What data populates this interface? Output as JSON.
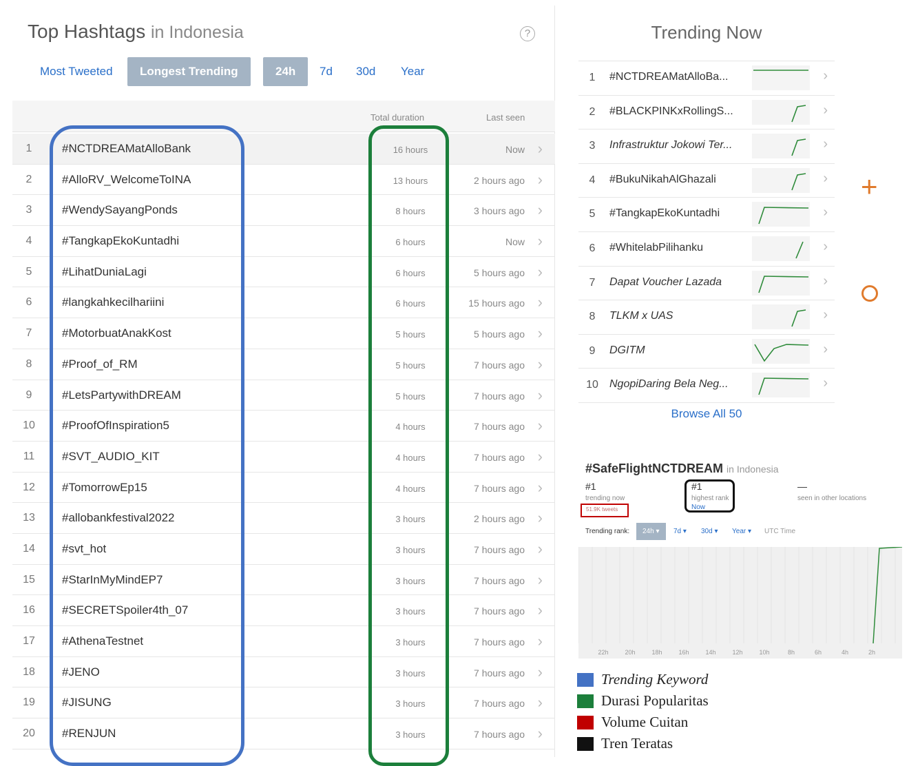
{
  "left": {
    "title": "Top Hashtags",
    "location": "in Indonesia",
    "help_icon": "?",
    "tabs": {
      "most_tweeted": "Most Tweeted",
      "longest_trending": "Longest Trending"
    },
    "periods": {
      "p24h": "24h",
      "p7d": "7d",
      "p30d": "30d",
      "year": "Year"
    },
    "columns": {
      "total_duration": "Total duration",
      "last_seen": "Last seen"
    },
    "rows": [
      {
        "rank": "1",
        "name": "#NCTDREAMatAlloBank",
        "duration": "16 hours",
        "last_seen": "Now"
      },
      {
        "rank": "2",
        "name": "#AlloRV_WelcomeToINA",
        "duration": "13 hours",
        "last_seen": "2 hours ago"
      },
      {
        "rank": "3",
        "name": "#WendySayangPonds",
        "duration": "8 hours",
        "last_seen": "3 hours ago"
      },
      {
        "rank": "4",
        "name": "#TangkapEkoKuntadhi",
        "duration": "6 hours",
        "last_seen": "Now"
      },
      {
        "rank": "5",
        "name": "#LihatDuniaLagi",
        "duration": "6 hours",
        "last_seen": "5 hours ago"
      },
      {
        "rank": "6",
        "name": "#langkahkecilhariini",
        "duration": "6 hours",
        "last_seen": "15 hours ago"
      },
      {
        "rank": "7",
        "name": "#MotorbuatAnakKost",
        "duration": "5 hours",
        "last_seen": "5 hours ago"
      },
      {
        "rank": "8",
        "name": "#Proof_of_RM",
        "duration": "5 hours",
        "last_seen": "7 hours ago"
      },
      {
        "rank": "9",
        "name": "#LetsPartywithDREAM",
        "duration": "5 hours",
        "last_seen": "7 hours ago"
      },
      {
        "rank": "10",
        "name": "#ProofOfInspiration5",
        "duration": "4 hours",
        "last_seen": "7 hours ago"
      },
      {
        "rank": "11",
        "name": "#SVT_AUDIO_KIT",
        "duration": "4 hours",
        "last_seen": "7 hours ago"
      },
      {
        "rank": "12",
        "name": "#TomorrowEp15",
        "duration": "4 hours",
        "last_seen": "7 hours ago"
      },
      {
        "rank": "13",
        "name": "#allobankfestival2022",
        "duration": "3 hours",
        "last_seen": "2 hours ago"
      },
      {
        "rank": "14",
        "name": "#svt_hot",
        "duration": "3 hours",
        "last_seen": "7 hours ago"
      },
      {
        "rank": "15",
        "name": "#StarInMyMindEP7",
        "duration": "3 hours",
        "last_seen": "7 hours ago"
      },
      {
        "rank": "16",
        "name": "#SECRETSpoiler4th_07",
        "duration": "3 hours",
        "last_seen": "7 hours ago"
      },
      {
        "rank": "17",
        "name": "#AthenaTestnet",
        "duration": "3 hours",
        "last_seen": "7 hours ago"
      },
      {
        "rank": "18",
        "name": "#JENO",
        "duration": "3 hours",
        "last_seen": "7 hours ago"
      },
      {
        "rank": "19",
        "name": "#JISUNG",
        "duration": "3 hours",
        "last_seen": "7 hours ago"
      },
      {
        "rank": "20",
        "name": "#RENJUN",
        "duration": "3 hours",
        "last_seen": "7 hours ago"
      }
    ]
  },
  "trending": {
    "title": "Trending Now",
    "browse": "Browse All 50",
    "items": [
      {
        "rank": "1",
        "name": "#NCTDREAMatAlloBa...",
        "italic": false,
        "spark": "flat"
      },
      {
        "rank": "2",
        "name": "#BLACKPINKxRollingS...",
        "italic": false,
        "spark": "rise"
      },
      {
        "rank": "3",
        "name": "Infrastruktur Jokowi Ter...",
        "italic": true,
        "spark": "rise"
      },
      {
        "rank": "4",
        "name": "#BukuNikahAlGhazali",
        "italic": false,
        "spark": "rise"
      },
      {
        "rank": "5",
        "name": "#TangkapEkoKuntadhi",
        "italic": false,
        "spark": "risehold"
      },
      {
        "rank": "6",
        "name": "#WhitelabPilihanku",
        "italic": false,
        "spark": "riselate"
      },
      {
        "rank": "7",
        "name": "Dapat Voucher Lazada",
        "italic": true,
        "spark": "risehold"
      },
      {
        "rank": "8",
        "name": "TLKM x UAS",
        "italic": true,
        "spark": "rise"
      },
      {
        "rank": "9",
        "name": "DGITM",
        "italic": true,
        "spark": "dip"
      },
      {
        "rank": "10",
        "name": "NgopiDaring Bela Neg...",
        "italic": true,
        "spark": "risehold"
      }
    ]
  },
  "detail": {
    "hashtag": "#SafeFlightNCTDREAM",
    "location": "in Indonesia",
    "trending_now_value": "#1",
    "trending_now_label": "trending now",
    "tweet_count": "51.9K tweets",
    "highest_rank_value": "#1",
    "highest_rank_label": "highest rank",
    "highest_rank_when": "Now",
    "other_locations_value": "—",
    "other_locations_label": "seen in other locations",
    "rank_label": "Trending rank:",
    "rank_24h": "24h",
    "rank_7d": "7d",
    "rank_30d": "30d",
    "rank_year": "Year",
    "rank_utc": "UTC Time",
    "x_ticks": [
      "22h",
      "20h",
      "18h",
      "16h",
      "14h",
      "12h",
      "10h",
      "8h",
      "6h",
      "4h",
      "2h"
    ]
  },
  "legend": [
    {
      "label": "Trending Keyword",
      "color": "#4472c4",
      "italic": true
    },
    {
      "label": "Durasi Popularitas",
      "color": "#1c7f3b",
      "italic": false
    },
    {
      "label": "Volume Cuitan",
      "color": "#c00000",
      "italic": false
    },
    {
      "label": "Tren Teratas",
      "color": "#111111",
      "italic": false
    }
  ],
  "colors": {
    "accent_blue": "#2a6fc9",
    "tab_selected": "#a4b4c4",
    "sparkline_green": "#2e8b3a",
    "mark_orange": "#e07b2d"
  }
}
